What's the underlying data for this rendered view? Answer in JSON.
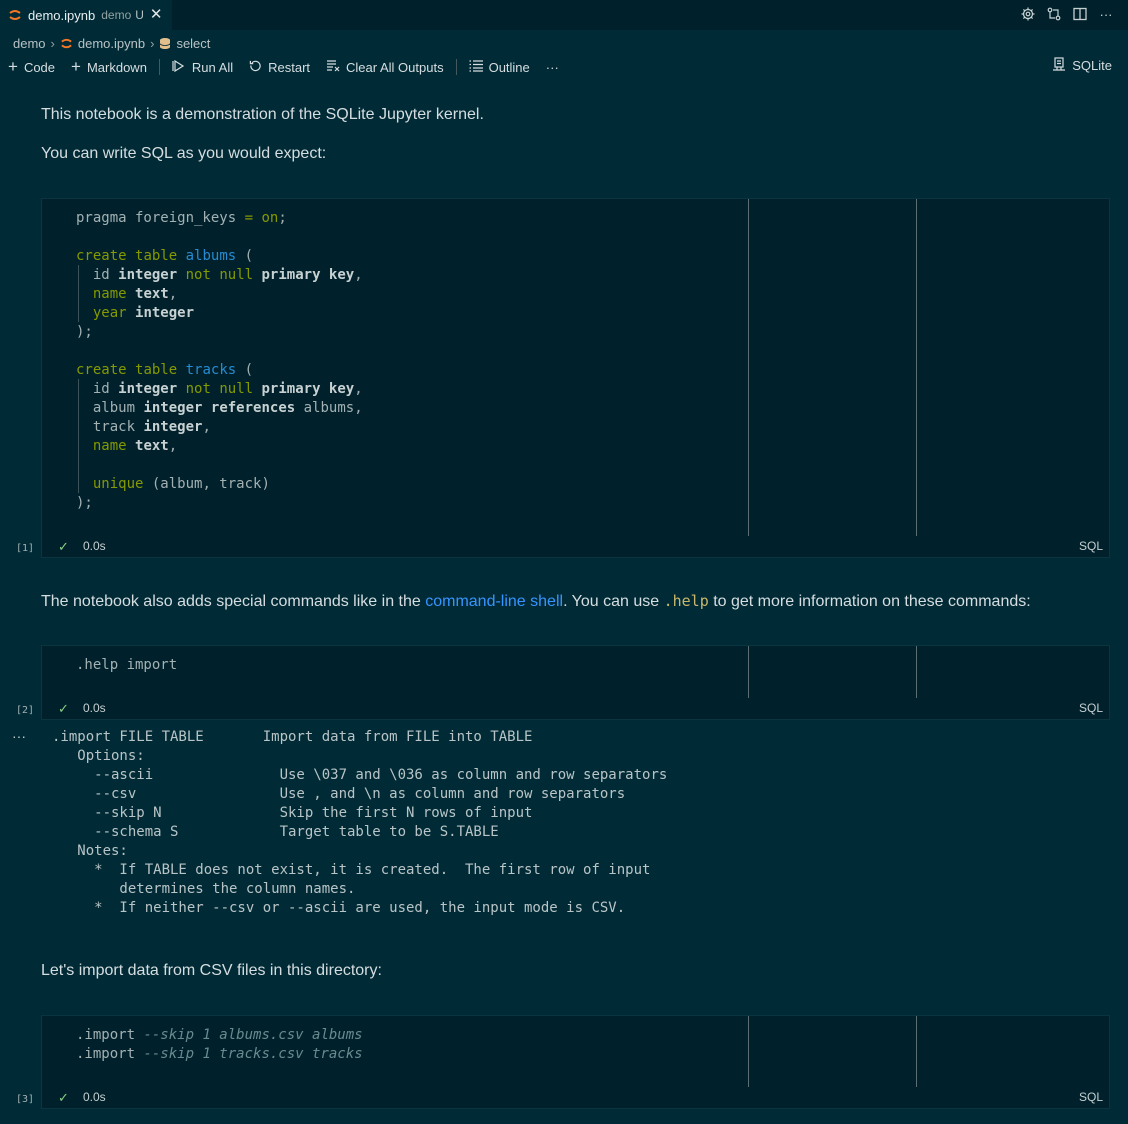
{
  "tab": {
    "name": "demo.ipynb",
    "description": "demo",
    "status": "U",
    "close": "✕"
  },
  "breadcrumb": {
    "folder": "demo",
    "file": "demo.ipynb",
    "symbol": "select"
  },
  "toolbar": {
    "code": "Code",
    "markdown": "Markdown",
    "run_all": "Run All",
    "restart": "Restart",
    "clear_outputs": "Clear All Outputs",
    "outline": "Outline",
    "more": "···",
    "kernel": "SQLite"
  },
  "markdown": {
    "intro": "This notebook is a demonstration of the SQLite Jupyter kernel.",
    "write_sql": "You can write SQL as you would expect:",
    "commands_pre": "The notebook also adds special commands like in the ",
    "commands_link": "command-line shell",
    "commands_mid": ". You can use ",
    "commands_code": ".help",
    "commands_post": " to get more information on these commands:",
    "import_intro": "Let's import data from CSV files in this directory:"
  },
  "cells": [
    {
      "count": "[1]",
      "time": "0.0s",
      "lang": "SQL"
    },
    {
      "count": "[2]",
      "time": "0.0s",
      "lang": "SQL",
      "code": ".help import"
    },
    {
      "count": "[3]",
      "time": "0.0s",
      "lang": "SQL"
    }
  ],
  "output": {
    "more": "···",
    "text": ".import FILE TABLE       Import data from FILE into TABLE\n   Options:\n     --ascii               Use \\037 and \\036 as column and row separators\n     --csv                 Use , and \\n as column and row separators\n     --skip N              Skip the first N rows of input\n     --schema S            Target table to be S.TABLE\n   Notes:\n     *  If TABLE does not exist, it is created.  The first row of input\n        determines the column names.\n     *  If neither --csv or --ascii are used, the input mode is CSV."
  },
  "colors": {
    "background": "#002b36",
    "cell": "#00212b",
    "keyword": "#859900",
    "identifier": "#268bd2",
    "link": "#3794ff",
    "check": "#89d185"
  }
}
